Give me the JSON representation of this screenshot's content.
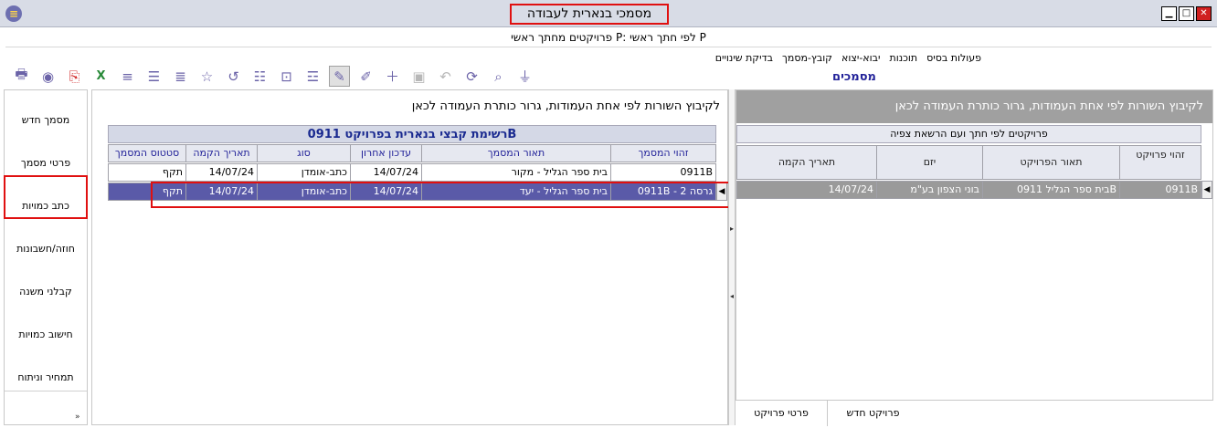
{
  "window": {
    "title": "מסמכי בנארית לעבודה",
    "subheader": "פרויקטים מחתך ראשי P: לפי חתך ראשי P"
  },
  "menubar": [
    "פעולות בסיס",
    "תוכנות",
    "יבוא-יצוא",
    "קובץ-מסמך",
    "בדיקת שינויים"
  ],
  "right_panel": {
    "title": "מסמכים",
    "drag_hint": "לקיבוץ השורות לפי אחת העמודות, גרור כותרת העמודה לכאן",
    "group_header": "פרויקטים לפי חתך ועם הרשאת צפיה",
    "columns": [
      "זהוי פרויקט",
      "תאור הפרויקט",
      "יזם",
      "תאריך הקמה"
    ],
    "rows": [
      {
        "id": "0911B",
        "desc": "בית ספר הגליל 0911B",
        "entrepreneur": "בוני הצפון בע\"מ",
        "date": "14/07/24"
      }
    ]
  },
  "mid_panel": {
    "drag_hint": "לקיבוץ השורות לפי אחת העמודות, גרור כותרת העמודה לכאן",
    "caption": "רשימת קבצי בנארית בפרויקט 0911B",
    "columns": [
      "זהוי המסמך",
      "תאור המסמך",
      "עדכון אחרון",
      "סוג",
      "תאריך הקמה",
      "סטטוס המסמך"
    ],
    "rows": [
      {
        "id": "0911B",
        "desc": "בית ספר הגליל - מקור",
        "updated": "14/07/24",
        "type": "כתב-אומדן",
        "created": "14/07/24",
        "status": "תקף"
      },
      {
        "id": "0911B - גרסה 2",
        "desc": "בית ספר הגליל - יעד",
        "updated": "14/07/24",
        "type": "כתב-אומדן",
        "created": "14/07/24",
        "status": "תקף"
      }
    ]
  },
  "sidenav": [
    "מסמך חדש",
    "פרטי מסמך",
    "כתב כמויות",
    "חוזה/חשבונות",
    "קבלני משנה",
    "חישוב כמויות",
    "תמחיר וניתוח"
  ],
  "bottom_tabs": [
    "פרויקט חדש",
    "פרטי פרויקט"
  ],
  "toolbar_icons": [
    "print-icon",
    "preview-icon",
    "pdf-icon",
    "excel-icon",
    "indent-plus-icon",
    "lines-icon",
    "lines-plus-icon",
    "star-icon",
    "star-back-icon",
    "align-icon",
    "export-icon",
    "list-icon",
    "pen-cross-icon",
    "edit-icon",
    "plus-icon",
    "save-icon",
    "undo-icon",
    "refresh-icon",
    "search-icon",
    "filter-icon"
  ],
  "colors": {
    "accent": "#222299",
    "selected_row": "#5a5aa8",
    "highlight": "#e01010"
  }
}
